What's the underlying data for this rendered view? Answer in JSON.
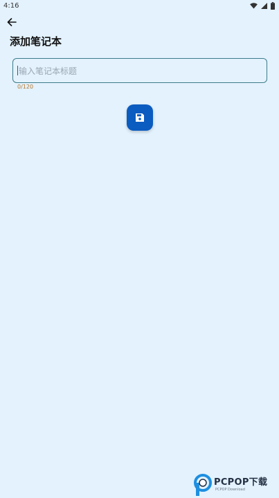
{
  "status_bar": {
    "time": "4:16",
    "icons": [
      "wifi-icon",
      "signal-icon",
      "battery-icon"
    ]
  },
  "app_bar": {
    "back_icon": "arrow-back-icon",
    "title": "添加笔记本"
  },
  "form": {
    "title_input": {
      "value": "",
      "placeholder": "输入笔记本标题"
    },
    "counter": "0/120"
  },
  "save_button": {
    "icon": "floppy-disk-icon"
  },
  "watermark": {
    "brand": "PCPOP下载",
    "sub": "PCPOP Download"
  },
  "colors": {
    "background": "#e3f2fd",
    "input_border": "#3c7a89",
    "accent": "#0b5cc0",
    "counter": "#b4762d"
  }
}
